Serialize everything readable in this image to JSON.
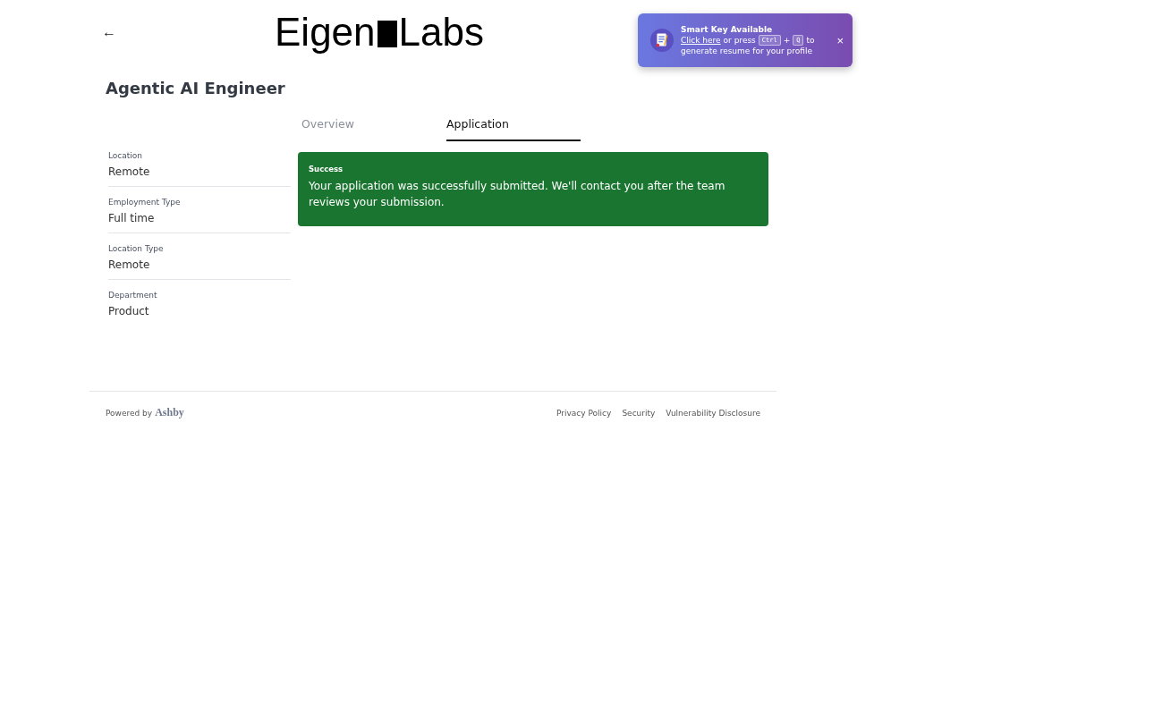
{
  "header": {
    "back": "←",
    "logo": [
      "Eigen",
      "Labs"
    ]
  },
  "toast": {
    "title": "Smart Key Available",
    "parts": [
      {
        "kind": "link",
        "text": "Click here"
      },
      {
        "kind": "text",
        "text": "or press"
      },
      {
        "kind": "key",
        "text": "Ctrl"
      },
      {
        "kind": "text",
        "text": "+"
      },
      {
        "kind": "key",
        "text": "Q"
      },
      {
        "kind": "text",
        "text": "to"
      }
    ],
    "line_2": "generate resume for your profile",
    "close": "×"
  },
  "job": {
    "title": "Agentic AI Engineer"
  },
  "tabs": [
    {
      "label": "Overview",
      "selected": false
    },
    {
      "label": "Application",
      "selected": true
    }
  ],
  "details": [
    {
      "label": "Location",
      "value": "Remote"
    },
    {
      "label": "Employment Type",
      "value": "Full time"
    },
    {
      "label": "Location Type",
      "value": "Remote"
    },
    {
      "label": "Department",
      "value": "Product"
    }
  ],
  "alert": {
    "title": "Success",
    "message": "Your application was successfully submitted. We'll contact you after the team reviews your submission."
  },
  "footer": {
    "powered_by": "Powered by",
    "brand": "Ashby",
    "links": [
      "Privacy Policy",
      "Security",
      "Vulnerability Disclosure"
    ]
  }
}
